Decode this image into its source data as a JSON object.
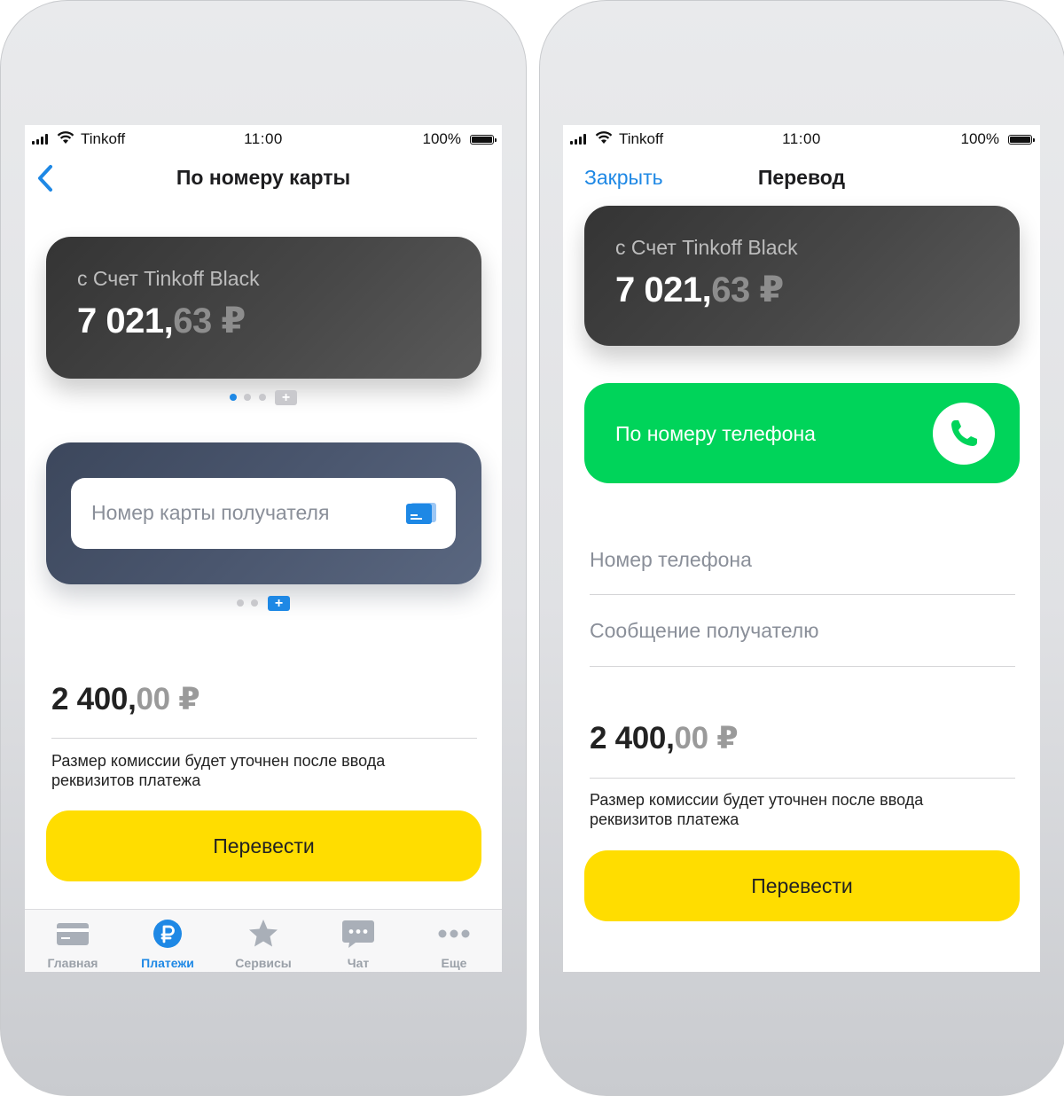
{
  "status_bar": {
    "carrier": "Tinkoff",
    "time": "11:00",
    "battery": "100%"
  },
  "left_screen": {
    "title": "По номеру карты",
    "account": {
      "from_label": "с Счет Tinkoff Black",
      "amount_int": "7 021,",
      "amount_frac": "63 ₽"
    },
    "account_pager": {
      "dots": 3,
      "active_index": 0,
      "add": "+"
    },
    "recipient_input": {
      "placeholder": "Номер карты получателя"
    },
    "recipient_pager": {
      "dots": 2,
      "add": "+"
    },
    "sum": {
      "int": "2 400,",
      "frac": "00 ₽"
    },
    "fee_note": "Размер комиссии будет уточнен после ввода реквизитов платежа",
    "submit": "Перевести",
    "tabbar": [
      {
        "label": "Главная",
        "icon": "card-icon",
        "active": false
      },
      {
        "label": "Платежи",
        "icon": "ruble-icon",
        "active": true
      },
      {
        "label": "Сервисы",
        "icon": "star-icon",
        "active": false
      },
      {
        "label": "Чат",
        "icon": "chat-icon",
        "active": false
      },
      {
        "label": "Еще",
        "icon": "more-icon",
        "active": false
      }
    ]
  },
  "right_screen": {
    "close": "Закрыть",
    "title": "Перевод",
    "account": {
      "from_label": "с Счет Tinkoff Black",
      "amount_int": "7 021,",
      "amount_frac": "63 ₽"
    },
    "phone_option": {
      "label": "По номеру телефона",
      "icon": "phone-icon"
    },
    "phone_field": {
      "placeholder": "Номер телефона"
    },
    "message_field": {
      "placeholder": "Сообщение получателю"
    },
    "sum": {
      "int": "2 400,",
      "frac": "00 ₽"
    },
    "fee_note": "Размер комиссии будет уточнен после ввода реквизитов платежа",
    "submit": "Перевести"
  },
  "colors": {
    "accent": "#1e88e5",
    "yellow": "#ffdd00",
    "green": "#00d45a"
  }
}
